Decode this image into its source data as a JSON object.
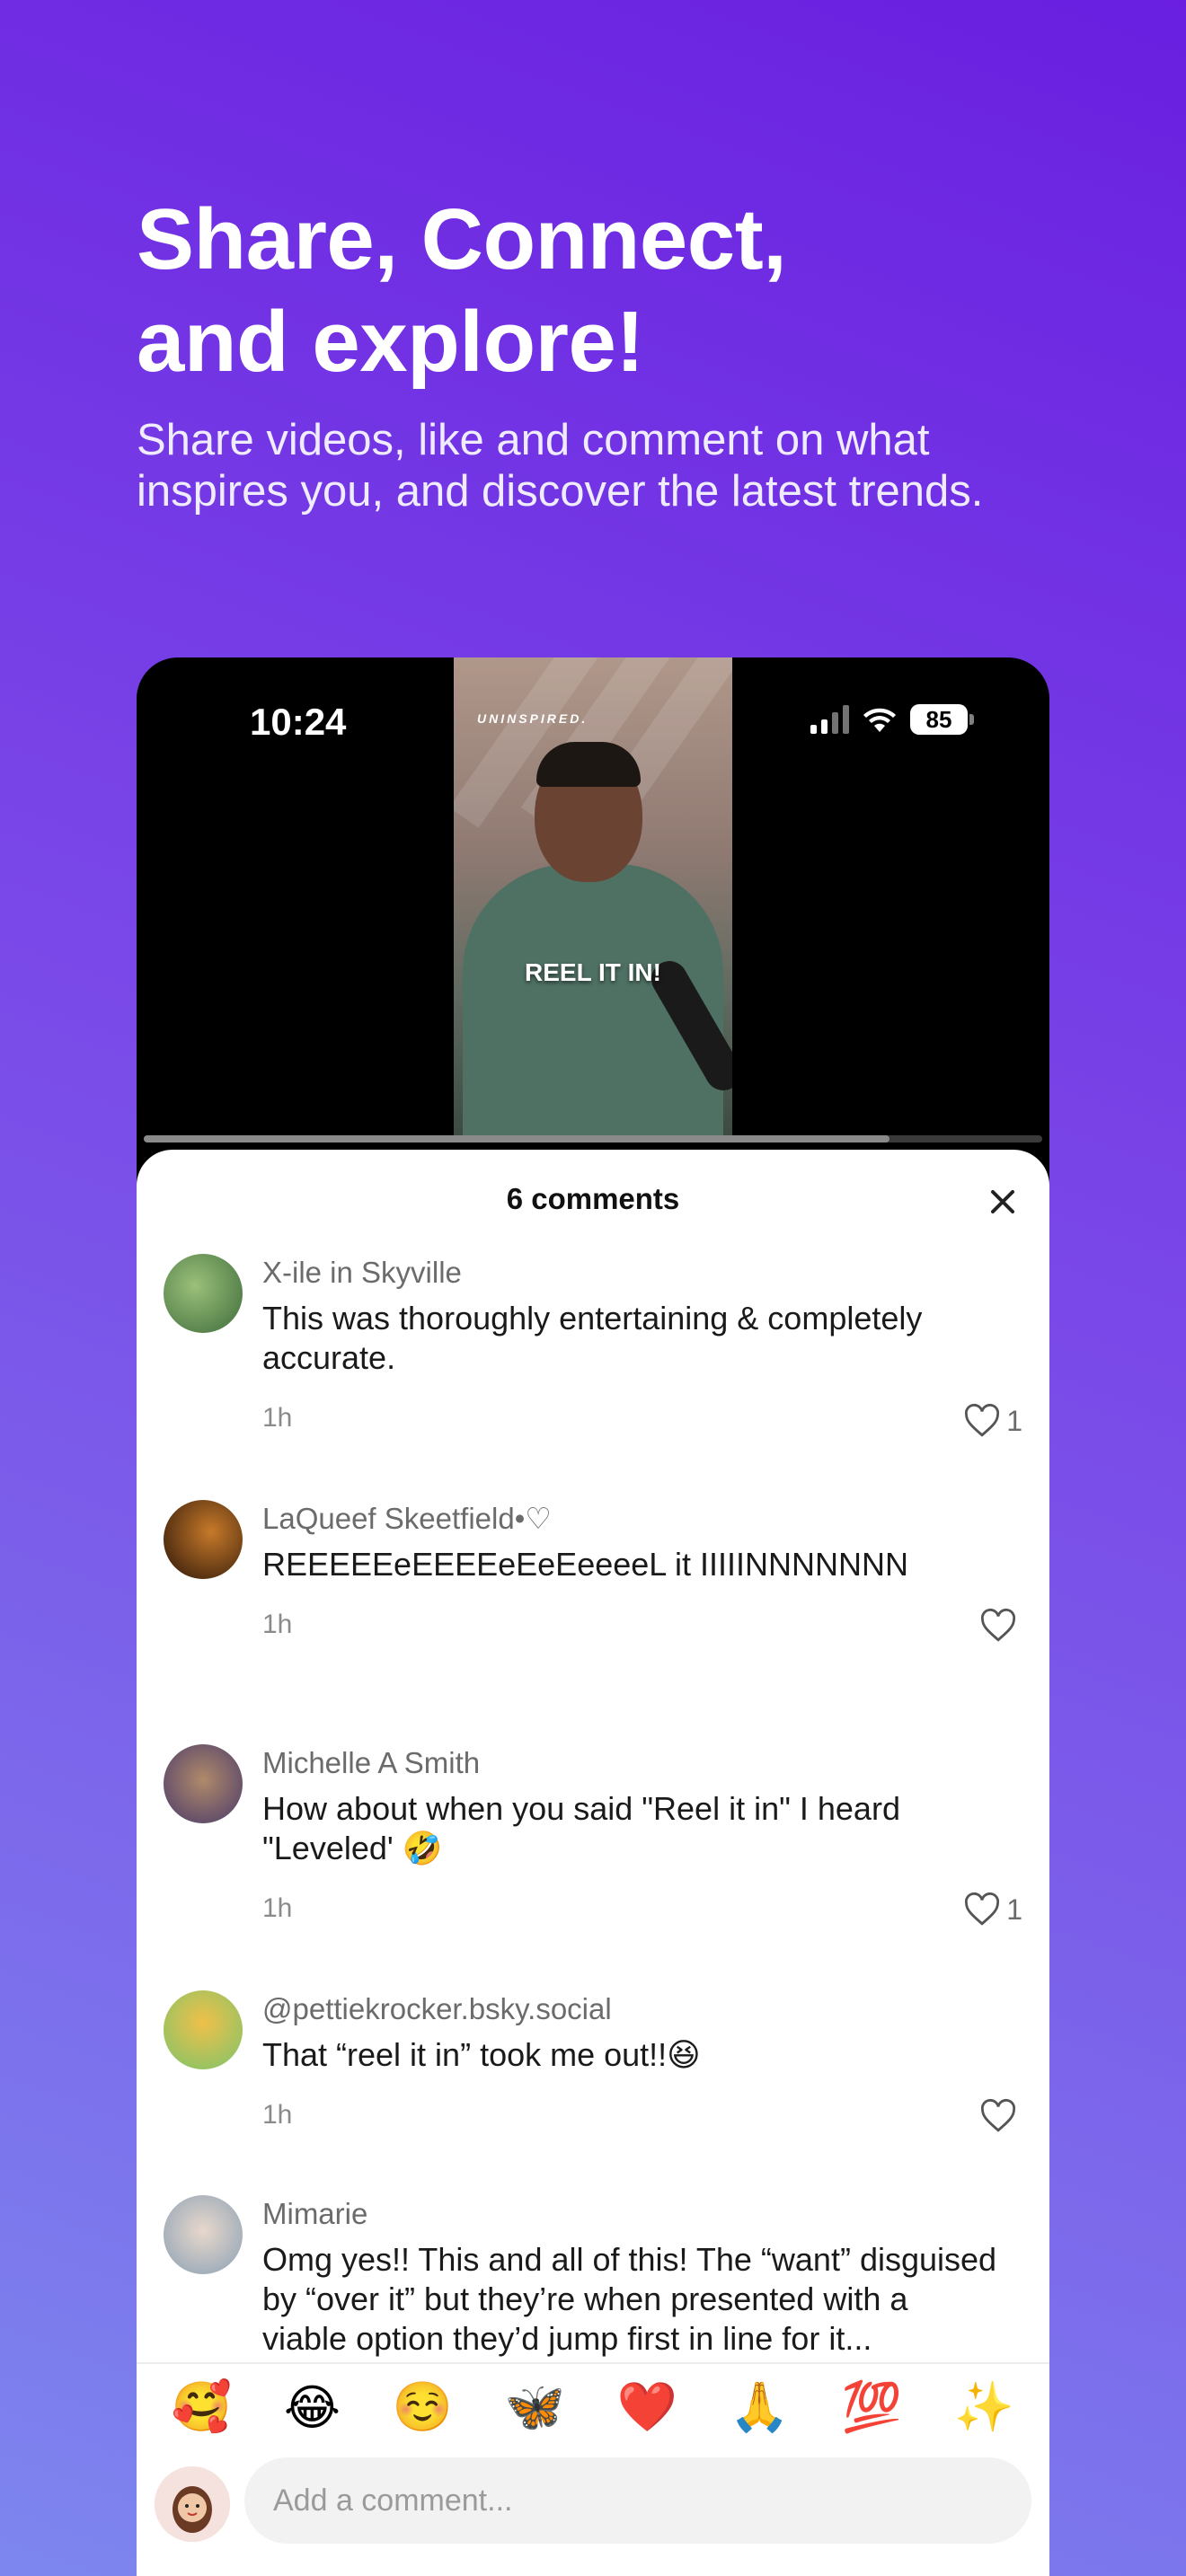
{
  "promo": {
    "headline_line1": "Share, Connect,",
    "headline_line2": "and explore!",
    "subline": "Share videos, like and comment on what inspires you, and discover the latest trends."
  },
  "status_bar": {
    "time": "10:24",
    "battery": "85"
  },
  "video": {
    "brand": "UNINSPIRED.",
    "caption": "REEL IT IN!",
    "progress": 0.83
  },
  "comments_sheet": {
    "title": "6 comments",
    "comments": [
      {
        "name": "X-ile in Skyville",
        "text": "This was thoroughly entertaining & completely accurate.",
        "time": "1h",
        "likes": "1"
      },
      {
        "name": "LaQueef Skeetfield•♡",
        "text": "REEEEEeEEEEeEeEeeeeL it IIIIINNNNNNN",
        "time": "1h",
        "likes": ""
      },
      {
        "name": "Michelle A Smith",
        "text": "How about when you said \"Reel it in\" I heard \"Leveled' 🤣",
        "time": "1h",
        "likes": "1"
      },
      {
        "name": "@pettiekrocker.bsky.social",
        "text": "That “reel it in” took me out!!😆",
        "time": "1h",
        "likes": ""
      },
      {
        "name": "Mimarie",
        "text": "Omg yes!! This and all of this! The “want” disguised by “over it” but they’re when presented with a viable option they’d jump first in line for it...",
        "time": "",
        "likes": ""
      }
    ]
  },
  "emoji_bar": [
    "🥰",
    "😂",
    "☺️",
    "🦋",
    "❤️",
    "🙏",
    "💯",
    "✨"
  ],
  "composer": {
    "placeholder": "Add a comment..."
  },
  "colors": {
    "gradient_top": "#6a1fe0",
    "gradient_bottom": "#7d86ee",
    "sheet_bg": "#ffffff"
  }
}
